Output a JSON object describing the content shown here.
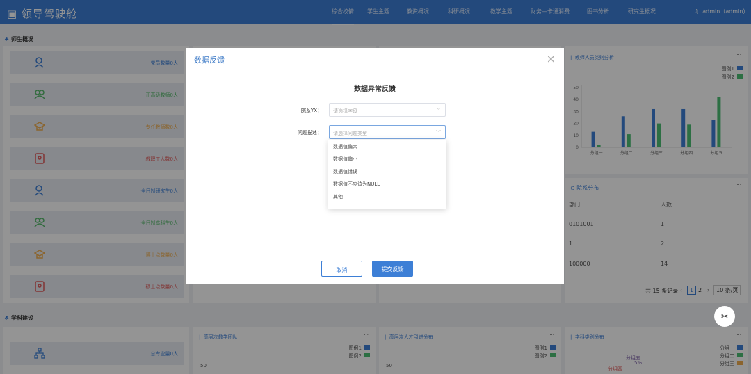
{
  "header": {
    "title": "领导驾驶舱",
    "nav": [
      "综合校情",
      "学生主题",
      "教资概况",
      "科研概况",
      "教学主题",
      "财务—卡通消费",
      "图书分析",
      "研究生概况"
    ],
    "user": "admin（admin）"
  },
  "sections": {
    "teachers": "师生概况",
    "discipline": "学科建设"
  },
  "stats": [
    {
      "label": "党员数量0人",
      "color": "#3d7fd6"
    },
    {
      "label": "正高级教师0人",
      "color": "#55b96a"
    },
    {
      "label": "专任教师数0人",
      "color": "#f0ad4e"
    },
    {
      "label": "教职工人数0人",
      "color": "#e05a5a"
    },
    {
      "label": "全日制研究生0人",
      "color": "#3d7fd6"
    },
    {
      "label": "全日制本科生0人",
      "color": "#55b96a"
    },
    {
      "label": "博士点数量0人",
      "color": "#f0ad4e"
    },
    {
      "label": "硕士点数量0人",
      "color": "#e05a5a"
    }
  ],
  "bottom_stat": {
    "label": "总专业量0人"
  },
  "panels": {
    "staff_chart": "教师人员类别分析",
    "dept": "院系分布",
    "team": "高层次教学团队",
    "talent": "高层次人才引进分布",
    "subject": "学科类别分布"
  },
  "legend": [
    "图例1",
    "图例2"
  ],
  "pie_legend": [
    "分组一",
    "分组二",
    "分组三"
  ],
  "pie_labels": {
    "a": "分组五",
    "b": "5%",
    "c": "分组四"
  },
  "chart_data": {
    "type": "bar",
    "categories": [
      "分组一",
      "分组二",
      "分组三",
      "分组四",
      "分组五"
    ],
    "series": [
      {
        "name": "图例1",
        "values": [
          13,
          26,
          32,
          32,
          23
        ]
      },
      {
        "name": "图例2",
        "values": [
          2,
          11,
          20,
          19,
          42
        ]
      }
    ],
    "ylim": [
      0,
      50
    ],
    "yticks": [
      "0",
      "10",
      "20",
      "30",
      "40",
      "50"
    ],
    "colors": [
      "#3d7fd6",
      "#4cbf74"
    ]
  },
  "small_axis": "50",
  "table": {
    "headers": [
      "部门",
      "人数"
    ],
    "rows": [
      [
        "0101001",
        "1"
      ],
      [
        "1",
        "2"
      ],
      [
        "100000",
        "14"
      ]
    ],
    "total": "共 15 条记录",
    "pages": [
      "1",
      "2"
    ],
    "per_page": "10 条/页"
  },
  "dialog": {
    "title": "数据反馈",
    "form_title": "数据异常反馈",
    "field1_label": "院系YX：",
    "field1_placeholder": "请选择字段",
    "field2_label": "问题描述：",
    "field2_placeholder": "请选择问题类型",
    "options": [
      "数据值偏大",
      "数据值偏小",
      "数据值错误",
      "数据值不应该为NULL",
      "其他"
    ],
    "cancel": "取消",
    "submit": "提交反馈"
  },
  "more": "···"
}
